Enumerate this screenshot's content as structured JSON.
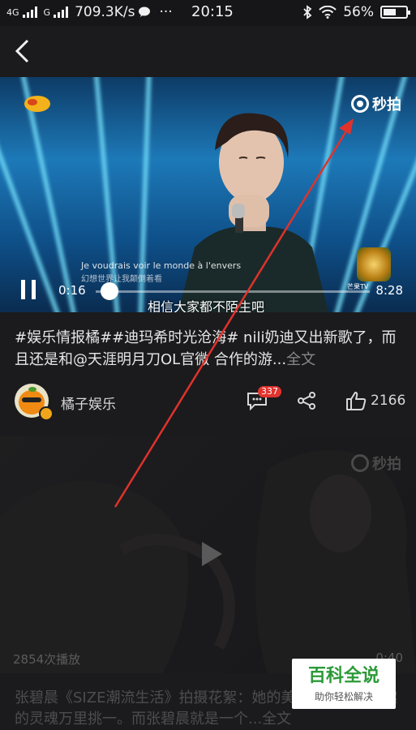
{
  "status_bar": {
    "sim1": "4G",
    "sim2": "G",
    "speed": "709.3K/s",
    "more": "···",
    "time": "20:15",
    "battery": "56%",
    "battery_level": 0.56
  },
  "video1": {
    "current_time": "0:16",
    "total_time": "8:28",
    "progress": 0.03,
    "subtitle_fr": "Je voudrais voir le monde à l'envers",
    "subtitle_cn_small": "幻想世界让我颠倒着看",
    "caption": "相信大家都不陌生吧",
    "watermark": "秒拍",
    "channel_tag": "芒果TV"
  },
  "post1": {
    "title": "#娱乐情报橘##迪玛希时光沧海# nili奶迪又出新歌了，而且还是和@天涯明月刀OL官微 合作的游...",
    "more_label": "全文",
    "author": "橘子娱乐",
    "comment_count": "337",
    "like_count": "2166"
  },
  "video2": {
    "watermark": "秒拍",
    "play_count": "2854次播放",
    "duration": "0:40"
  },
  "post2": {
    "title": "张碧晨《SIZE潮流生活》拍摄花絮：她的美千篇一律，有趣的灵魂万里挑一。而张碧晨就是一个...",
    "more_label": "全文"
  },
  "site_watermark": {
    "main": "百科全说",
    "sub": "助你轻松解决"
  },
  "colors": {
    "accent_red": "#e0322b",
    "background": "#1b1b1d",
    "watermark_green": "#2b9a38"
  }
}
